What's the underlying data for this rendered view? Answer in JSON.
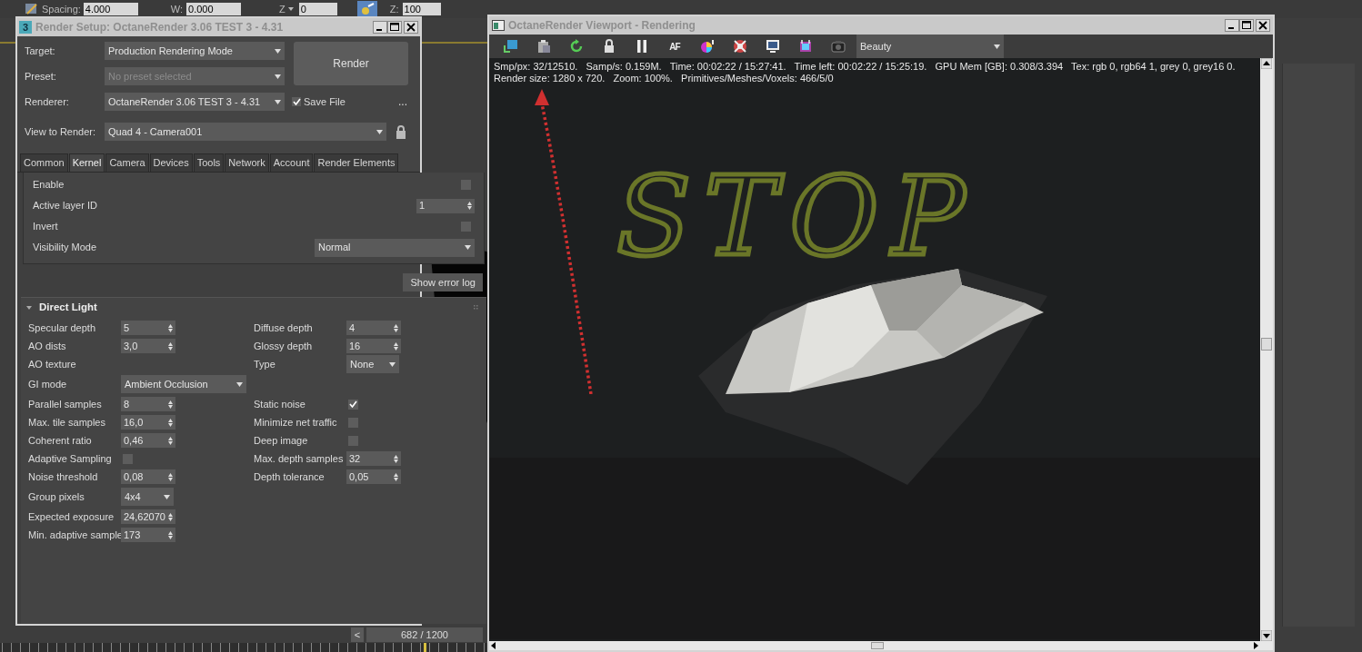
{
  "toolbar": {
    "spacing_label": "Spacing:",
    "spacing_value": "4.000",
    "w_label": "W:",
    "w_value": "0.000",
    "z_axis": "Z",
    "z_value": "0",
    "z2_label": "Z:",
    "z2_value": "100"
  },
  "render_setup": {
    "title": "Render Setup: OctaneRender 3.06 TEST 3 - 4.31",
    "app_badge": "3",
    "target": {
      "label": "Target:",
      "value": "Production Rendering Mode"
    },
    "preset": {
      "label": "Preset:",
      "value": "No preset selected",
      "disabled": true
    },
    "render_button": "Render",
    "renderer": {
      "label": "Renderer:",
      "value": "OctaneRender 3.06 TEST 3 - 4.31"
    },
    "save_file": {
      "label": "Save File",
      "checked": true
    },
    "more_button": "...",
    "view_to_render": {
      "label": "View to Render:",
      "value": "Quad 4 - Camera001"
    },
    "tabs": [
      {
        "label": "Common",
        "selected": false
      },
      {
        "label": "Kernel",
        "selected": true
      },
      {
        "label": "Camera",
        "selected": false
      },
      {
        "label": "Devices",
        "selected": false
      },
      {
        "label": "Tools",
        "selected": false
      },
      {
        "label": "Network",
        "selected": false
      },
      {
        "label": "Account",
        "selected": false
      },
      {
        "label": "Render Elements",
        "selected": false
      }
    ],
    "layer_rows": [
      {
        "kind": "checkbox",
        "label": "Enable",
        "checked": false
      },
      {
        "kind": "spinner",
        "label": "Active layer ID",
        "value": "1"
      },
      {
        "kind": "checkbox",
        "label": "Invert",
        "checked": false
      },
      {
        "kind": "dropdown",
        "label": "Visibility Mode",
        "value": "Normal"
      }
    ],
    "show_error_log": "Show error log",
    "direct_light": {
      "title": "Direct Light",
      "expanded": true,
      "rows": [
        {
          "left": {
            "kind": "spinner",
            "label": "Specular depth",
            "value": "5"
          },
          "right": {
            "kind": "spinner",
            "label": "Diffuse depth",
            "value": "4"
          }
        },
        {
          "left": {
            "kind": "spinner",
            "label": "AO dists",
            "value": "3,0"
          },
          "right": {
            "kind": "spinner",
            "label": "Glossy depth",
            "value": "16"
          }
        },
        {
          "left": {
            "kind": "label",
            "label": "AO texture"
          },
          "right": {
            "kind": "dropdown",
            "label": "Type",
            "value": "None"
          }
        },
        {
          "left": {
            "kind": "wide_dropdown",
            "label": "GI mode",
            "value": "Ambient Occlusion"
          }
        },
        {
          "left": {
            "kind": "spinner",
            "label": "Parallel samples",
            "value": "8"
          },
          "right": {
            "kind": "checkbox",
            "label": "Static noise",
            "checked": true
          }
        },
        {
          "left": {
            "kind": "spinner",
            "label": "Max. tile samples",
            "value": "16,0"
          },
          "right": {
            "kind": "checkbox",
            "label": "Minimize net traffic",
            "checked": false
          }
        },
        {
          "left": {
            "kind": "spinner",
            "label": "Coherent ratio",
            "value": "0,46"
          },
          "right": {
            "kind": "checkbox",
            "label": "Deep image",
            "checked": false
          }
        },
        {
          "left": {
            "kind": "checkbox",
            "label": "Adaptive Sampling",
            "checked": false
          },
          "right": {
            "kind": "spinner",
            "label": "Max. depth samples",
            "value": "32"
          }
        },
        {
          "left": {
            "kind": "spinner",
            "label": "Noise threshold",
            "value": "0,08"
          },
          "right": {
            "kind": "spinner",
            "label": "Depth tolerance",
            "value": "0,05"
          }
        },
        {
          "left": {
            "kind": "dropdown",
            "label": "Group pixels",
            "value": "4x4"
          }
        },
        {
          "left": {
            "kind": "spinner",
            "label": "Expected exposure",
            "value": "24,62070"
          }
        },
        {
          "left": {
            "kind": "spinner",
            "label": "Min. adaptive sample",
            "value": "173"
          }
        }
      ]
    }
  },
  "viewport": {
    "title": "OctaneRender Viewport - Rendering",
    "af_label": "AF",
    "pass": "Beauty",
    "stats": [
      "Smp/px: 32/12510.   Samp/s: 0.159M.   Time: 00:02:22 / 15:27:41.   Time left: 00:02:22 / 15:25:19.   GPU Mem [GB]: 0.308/3.394   Tex: rgb 0, rgb64 1, grey 0, grey16 0.",
      "Render size: 1280 x 720.   Zoom: 100%.   Primitives/Meshes/Voxels: 466/5/0"
    ],
    "annotation": "STOP"
  },
  "timeline": {
    "prev": "<",
    "frame": "682 / 1200"
  }
}
